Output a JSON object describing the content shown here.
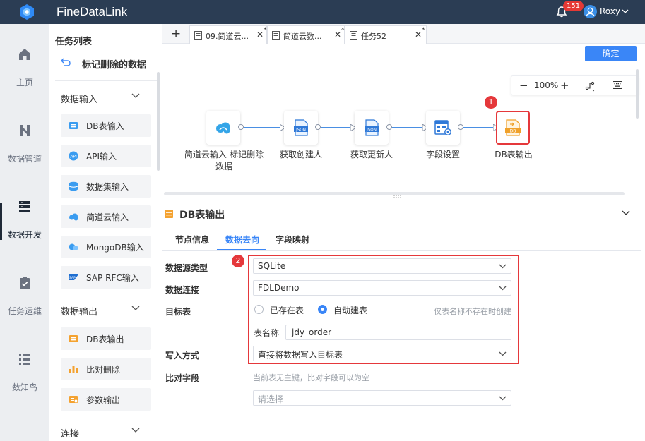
{
  "app": {
    "title": "FineDataLink"
  },
  "header": {
    "notification_count": "151",
    "username": "Roxy"
  },
  "leftnav": {
    "items": [
      {
        "label": "主页",
        "icon": "home-icon"
      },
      {
        "label": "数据管道",
        "icon": "pipeline-icon"
      },
      {
        "label": "数据开发",
        "icon": "data-dev-icon"
      },
      {
        "label": "任务运维",
        "icon": "task-ops-icon"
      },
      {
        "label": "数知鸟",
        "icon": "list-icon"
      }
    ]
  },
  "taskpanel": {
    "title": "任务列表",
    "task_name": "标记删除的数据",
    "groups": [
      {
        "title": "数据输入",
        "items": [
          "DB表输入",
          "API输入",
          "数据集输入",
          "简道云输入",
          "MongoDB输入",
          "SAP RFC输入"
        ]
      },
      {
        "title": "数据输出",
        "items": [
          "DB表输出",
          "比对删除",
          "参数输出"
        ]
      },
      {
        "title": "连接",
        "items": []
      }
    ]
  },
  "tabs": [
    {
      "label": "09.简道云...",
      "modified": "*"
    },
    {
      "label": "简道云数...",
      "modified": "*"
    },
    {
      "label": "任务52",
      "modified": "*"
    }
  ],
  "toolbar": {
    "add_tab": "+",
    "confirm_label": "确定"
  },
  "zoom": {
    "minus": "−",
    "level": "100%",
    "plus": "+"
  },
  "flow": {
    "nodes": [
      {
        "label": "简道云输入-标记删除数据",
        "icon": "cloud-icon"
      },
      {
        "label": "获取创建人",
        "icon": "json-icon",
        "icon_text": "JSON"
      },
      {
        "label": "获取更新人",
        "icon": "json-icon",
        "icon_text": "JSON"
      },
      {
        "label": "字段设置",
        "icon": "field-settings-icon"
      },
      {
        "label": "DB表输出",
        "icon": "db-output-icon",
        "icon_text": "DB"
      }
    ],
    "markers": [
      "1",
      "2"
    ]
  },
  "config": {
    "title": "DB表输出",
    "tabs": [
      "节点信息",
      "数据去向",
      "字段映射"
    ],
    "active_tab": "数据去向",
    "fields": {
      "source_type_label": "数据源类型",
      "source_type_value": "SQLite",
      "connection_label": "数据连接",
      "connection_value": "FDLDemo",
      "target_label": "目标表",
      "radio_existing": "已存在表",
      "radio_auto": "自动建表",
      "auto_hint": "仅表名称不存在时创建",
      "table_name_label": "表名称",
      "table_name_value": "jdy_order",
      "write_mode_label": "写入方式",
      "write_mode_value": "直接将数据写入目标表",
      "compare_label": "比对字段",
      "compare_hint": "当前表无主键，比对字段可以为空",
      "compare_placeholder": "请选择"
    }
  },
  "colors": {
    "accent": "#3a86f7",
    "topbar": "#2b3d54",
    "highlight": "#e5383b",
    "edge": "#4a8fe3"
  }
}
